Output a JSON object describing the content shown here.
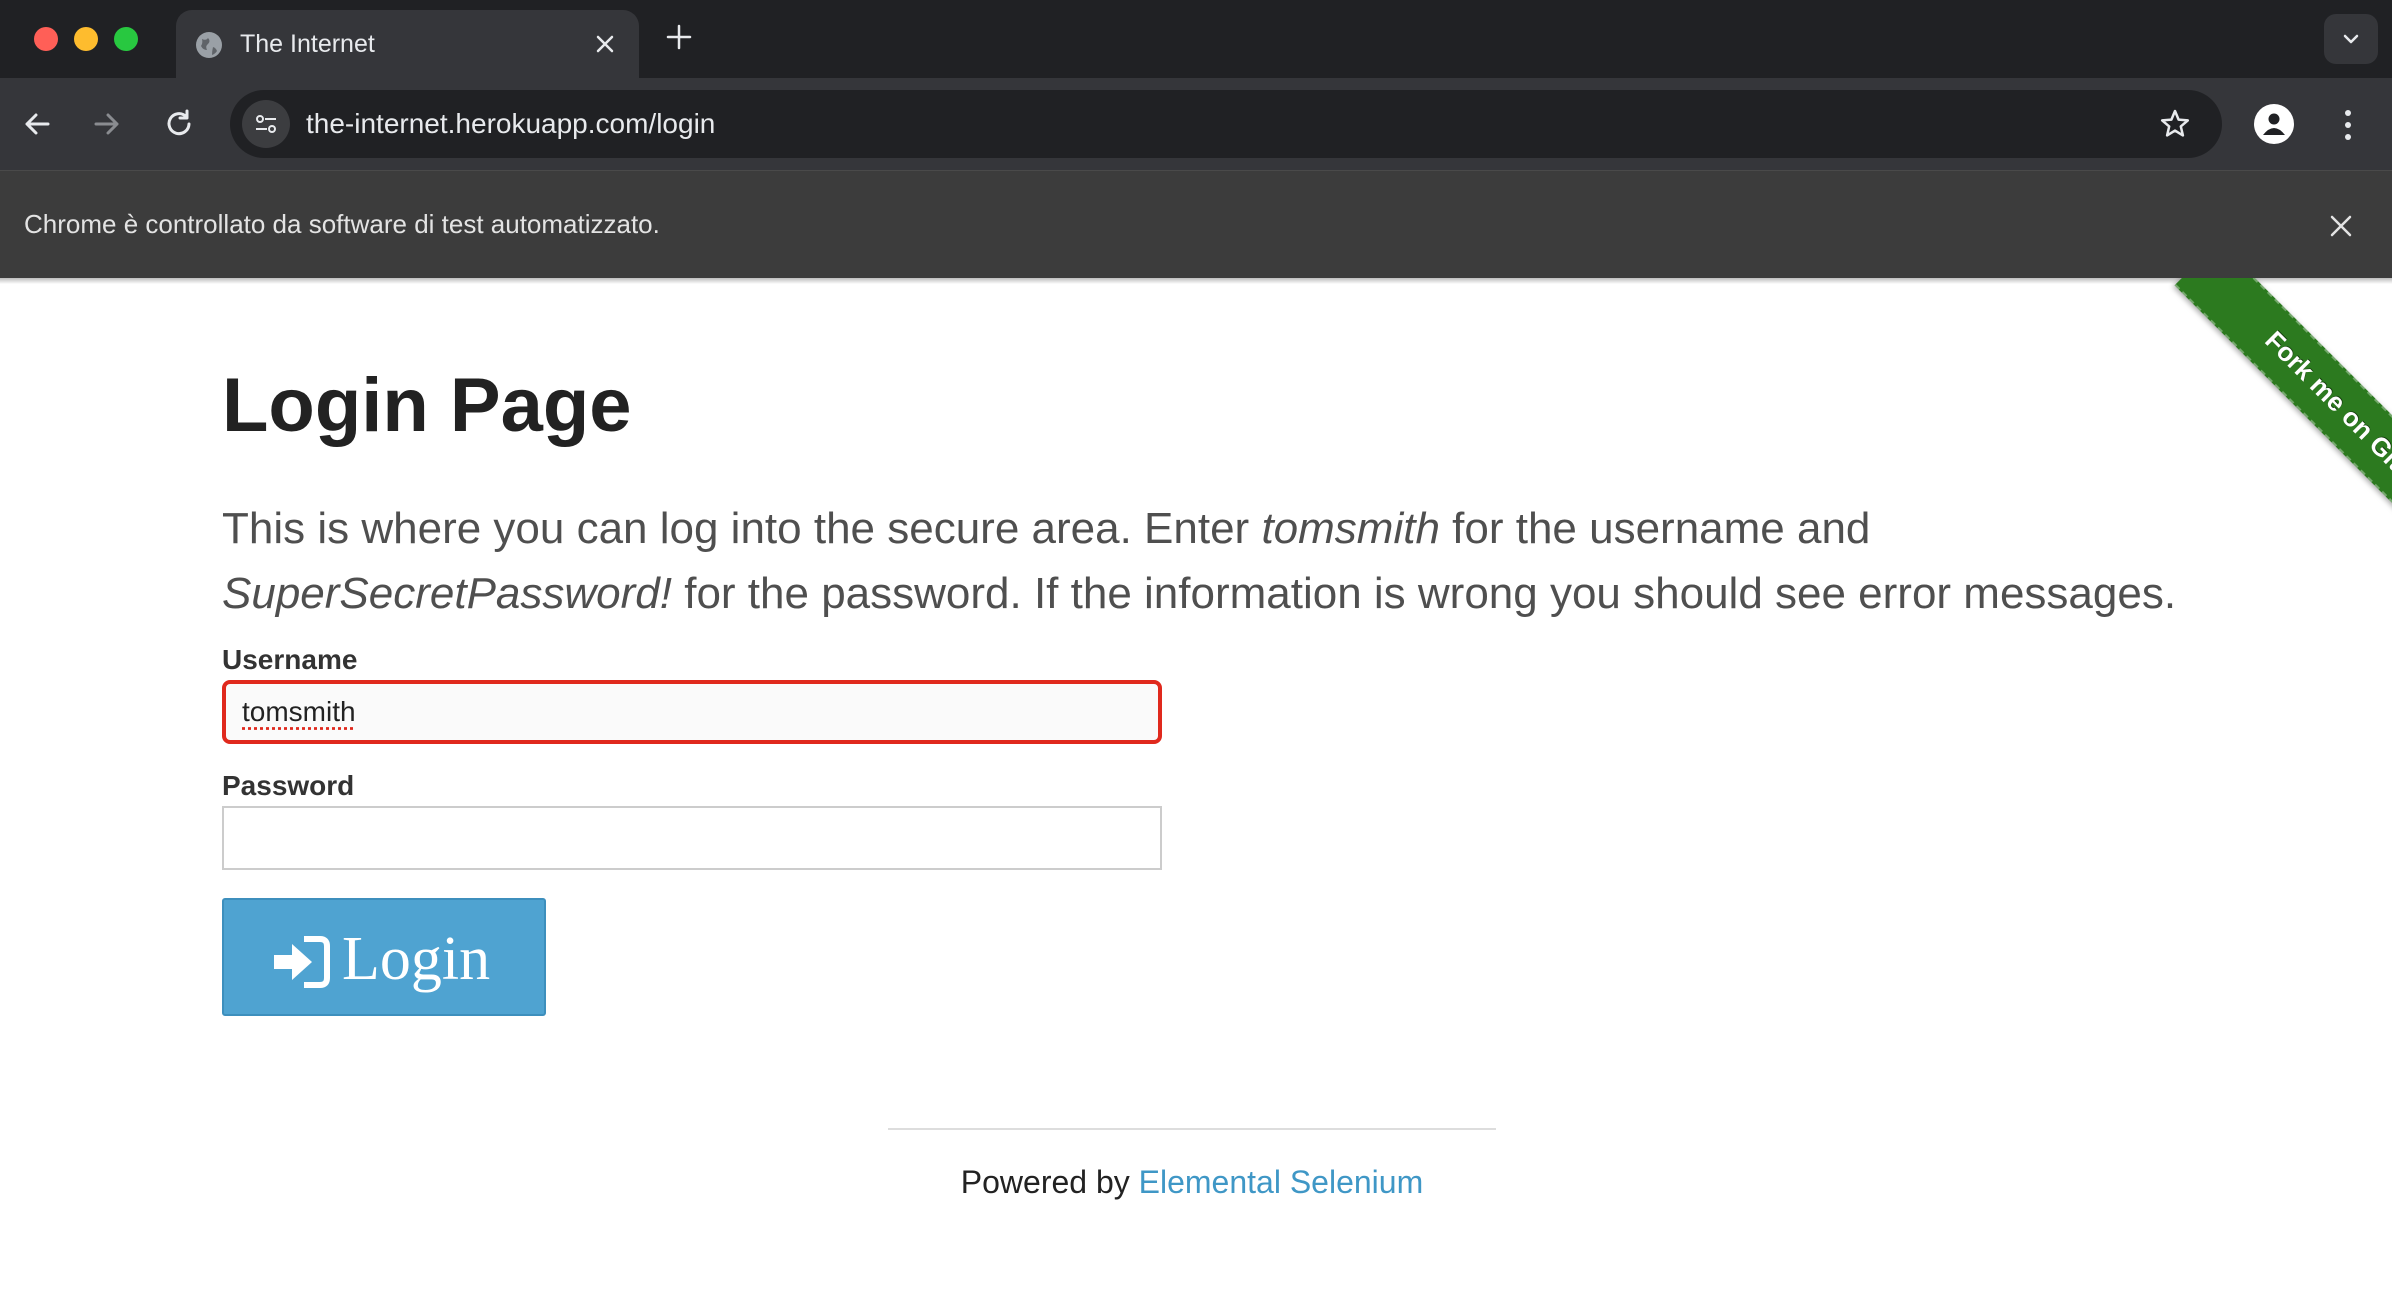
{
  "browser": {
    "tab_title": "The Internet",
    "url": "the-internet.herokuapp.com/login",
    "infobar_text": "Chrome è controllato da software di test automatizzato."
  },
  "page": {
    "ribbon_text": "Fork me on GitHub",
    "title": "Login Page",
    "subheader": {
      "part1": "This is where you can log into the secure area. Enter ",
      "username_hint": "tomsmith",
      "part2": " for the username and ",
      "password_hint": "SuperSecretPassword!",
      "part3": " for the password. If the information is wrong you should see error messages."
    },
    "form": {
      "username_label": "Username",
      "username_value": "tomsmith",
      "password_label": "Password",
      "password_value": "",
      "login_button": "Login"
    },
    "footer": {
      "prefix": "Powered by ",
      "link_text": "Elemental Selenium"
    }
  },
  "colors": {
    "accent_blue": "#4fa3d1",
    "focus_red": "#e0291d",
    "ribbon_green": "#2c7a1f",
    "link_blue": "#3f97c6"
  }
}
